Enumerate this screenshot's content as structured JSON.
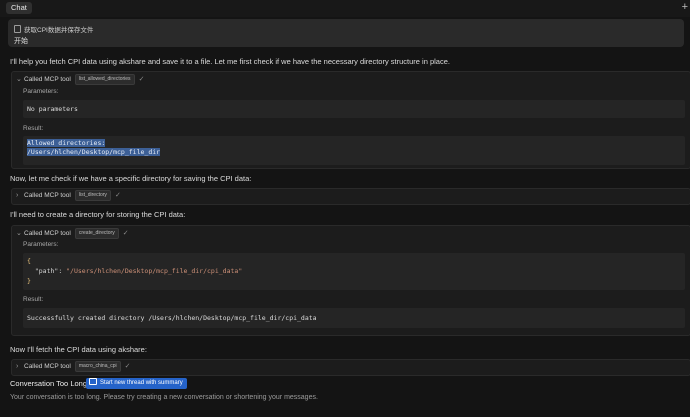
{
  "tabbar": {
    "tab_label": "Chat",
    "new_icon": "+"
  },
  "user_message": {
    "file_label": "获取CPI数据并保存文件",
    "text": "开始"
  },
  "messages": {
    "m1": "I'll help you fetch CPI data using akshare and save it to a file. Let me first check if we have the necessary directory structure in place.",
    "m2": "Now, let me check if we have a specific directory for saving the CPI data:",
    "m3": "I'll need to create a directory for storing the CPI data:",
    "m4": "Now I'll fetch the CPI data using akshare:"
  },
  "tools": {
    "t1": {
      "label": "Called MCP tool",
      "name": "list_allowed_directories",
      "params_label": "Parameters:",
      "params": "No parameters",
      "result_label": "Result:",
      "result_line1": "Allowed directories:",
      "result_line2": "/Users/hlchen/Desktop/mcp_file_dir"
    },
    "t2": {
      "label": "Called MCP tool",
      "name": "list_directory"
    },
    "t3": {
      "label": "Called MCP tool",
      "name": "create_directory",
      "params_label": "Parameters:",
      "brace_open": "{",
      "key": "\"path\"",
      "colon": ": ",
      "value": "\"/Users/hlchen/Desktop/mcp_file_dir/cpi_data\"",
      "brace_close": "}",
      "result_label": "Result:",
      "result": "Successfully created directory /Users/hlchen/Desktop/mcp_file_dir/cpi_data"
    },
    "t4": {
      "label": "Called MCP tool",
      "name": "macro_china_cpi"
    }
  },
  "footer": {
    "too_long": "Conversation Too Long",
    "new_thread_button": "Start new thread with summary",
    "hint": "Your conversation is too long. Please try creating a new conversation or shortening your messages."
  },
  "icons": {
    "chevron_down": "⌄",
    "chevron_right": "›",
    "check": "✓"
  },
  "colors": {
    "background": "#141414",
    "accent": "#2563c9",
    "selection": "#3c5f96",
    "string": "#ce9178",
    "brace": "#e5c07b"
  }
}
